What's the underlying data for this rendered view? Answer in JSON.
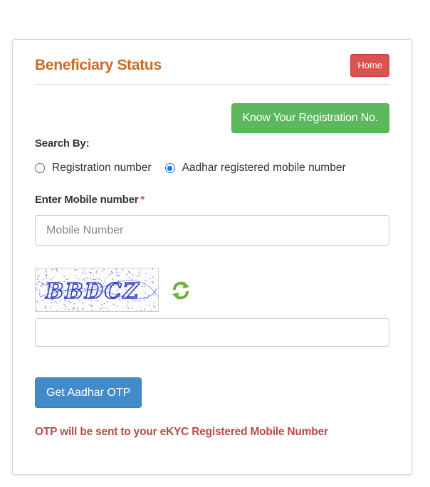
{
  "header": {
    "title": "Beneficiary Status",
    "home_label": "Home"
  },
  "know_registration_label": "Know Your Registration No.",
  "search": {
    "label": "Search By:",
    "options": [
      {
        "label": "Registration number",
        "selected": false
      },
      {
        "label": "Aadhar registered mobile number",
        "selected": true
      }
    ]
  },
  "mobile": {
    "label": "Enter Mobile number",
    "required_mark": "*",
    "placeholder": "Mobile Number",
    "value": ""
  },
  "captcha": {
    "image_text": "BBDCZ",
    "input_value": "",
    "refresh_icon": "refresh-icon"
  },
  "otp_button_label": "Get Aadhar OTP",
  "otp_note": "OTP will be sent to your eKYC Registered Mobile Number",
  "colors": {
    "title": "#d0691e",
    "home": "#d9534f",
    "know_button": "#5cb85c",
    "otp_button": "#428bca",
    "note": "#b94a48",
    "refresh": "#6cb33f",
    "captcha_text": "#2b3fbf"
  }
}
